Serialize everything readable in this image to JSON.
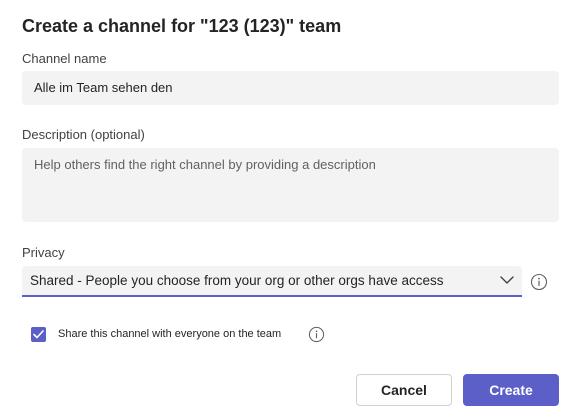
{
  "dialog": {
    "title": "Create a channel for \"123 (123)\" team"
  },
  "channel_name": {
    "label": "Channel name",
    "value": "Alle im Team sehen den"
  },
  "description": {
    "label": "Description (optional)",
    "placeholder": "Help others find the right channel by providing a description"
  },
  "privacy": {
    "label": "Privacy",
    "selected": "Shared - People you choose from your org or other orgs have access",
    "icon": "chevron-down-icon",
    "info_icon": "info-icon"
  },
  "share_option": {
    "label": "Share this channel with everyone on the team",
    "checked": true,
    "info_icon": "info-icon"
  },
  "buttons": {
    "cancel_label": "Cancel",
    "create_label": "Create"
  },
  "colors": {
    "accent": "#5b5fc7",
    "field_bg": "#f3f3f3"
  }
}
